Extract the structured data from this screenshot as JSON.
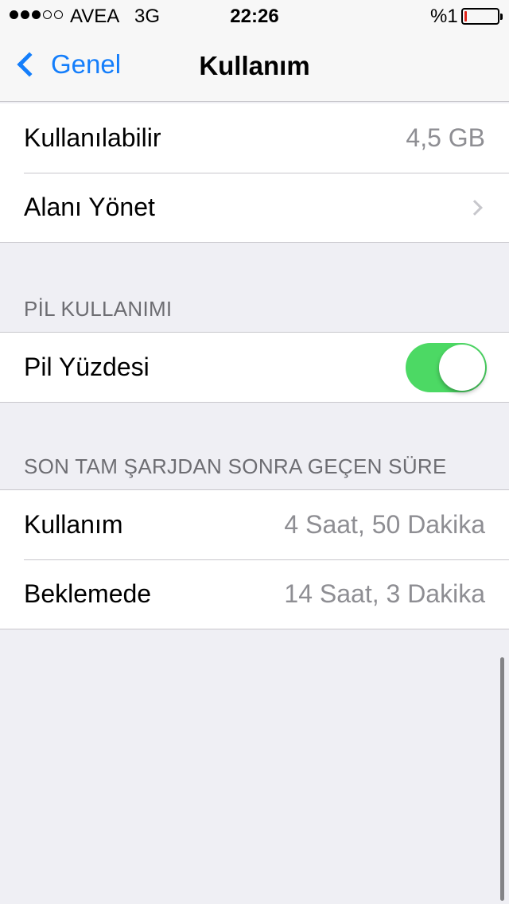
{
  "status_bar": {
    "signal_filled": 3,
    "signal_total": 5,
    "carrier": "AVEA",
    "network": "3G",
    "time": "22:26",
    "battery_text": "%1",
    "battery_level": 0.01
  },
  "nav": {
    "back_label": "Genel",
    "title": "Kullanım"
  },
  "storage": {
    "available_label": "Kullanılabilir",
    "available_value": "4,5 GB",
    "manage_label": "Alanı Yönet"
  },
  "battery_section": {
    "header": "PİL KULLANIMI",
    "percentage_label": "Pil Yüzdesi",
    "percentage_on": true
  },
  "time_section": {
    "header": "SON TAM ŞARJDAN SONRA GEÇEN SÜRE",
    "usage_label": "Kullanım",
    "usage_value": "4 Saat, 50 Dakika",
    "standby_label": "Beklemede",
    "standby_value": "14 Saat, 3 Dakika"
  },
  "colors": {
    "accent": "#147efb",
    "toggle_on": "#4cd964",
    "battery_low": "#e1251b"
  }
}
